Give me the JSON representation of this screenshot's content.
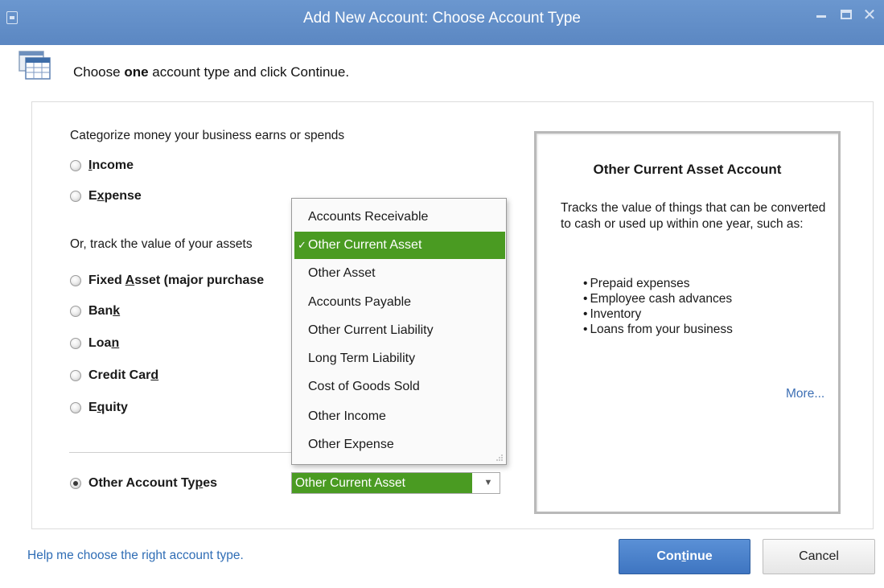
{
  "window": {
    "title": "Add New Account: Choose Account Type"
  },
  "header": {
    "instruction_pre": "Choose ",
    "instruction_bold": "one",
    "instruction_post": " account type and click Continue."
  },
  "left": {
    "categorize_label": "Categorize money your business earns or spends",
    "assets_label": "Or, track the value of your assets",
    "radio_options": [
      {
        "before": "",
        "mnemonic": "I",
        "after": "ncome",
        "checked": false
      },
      {
        "before": "E",
        "mnemonic": "x",
        "after": "pense",
        "checked": false
      },
      {
        "before": "Fixed ",
        "mnemonic": "A",
        "after": "sset (major purchase",
        "checked": false
      },
      {
        "before": "Ban",
        "mnemonic": "k",
        "after": "",
        "checked": false
      },
      {
        "before": "Loa",
        "mnemonic": "n",
        "after": "",
        "checked": false
      },
      {
        "before": "Credit Car",
        "mnemonic": "d",
        "after": "",
        "checked": false
      },
      {
        "before": "E",
        "mnemonic": "q",
        "after": "uity",
        "checked": false
      }
    ],
    "other_types": {
      "before": "Other Account Ty",
      "mnemonic": "p",
      "after": "es",
      "checked": true
    }
  },
  "combo": {
    "selected_value": "Other Current Asset"
  },
  "dropdown": {
    "items": [
      {
        "label": "Accounts Receivable",
        "selected": false
      },
      {
        "label": "Other Current Asset",
        "selected": true
      },
      {
        "label": "Other Asset",
        "selected": false
      },
      {
        "label": "Accounts Payable",
        "selected": false
      },
      {
        "label": "Other Current Liability",
        "selected": false
      },
      {
        "label": "Long Term Liability",
        "selected": false
      },
      {
        "label": "Cost of Goods Sold",
        "selected": false
      },
      {
        "label": "Other Income",
        "selected": false
      },
      {
        "label": "Other Expense",
        "selected": false
      }
    ],
    "check_mark": "✓"
  },
  "info": {
    "title": "Other Current Asset Account",
    "description": "Tracks the value of things that can be converted to cash or used up within one year, such as:",
    "bullets": [
      "Prepaid expenses",
      "Employee cash advances",
      "Inventory",
      "Loans from your business"
    ],
    "more_link": "More..."
  },
  "footer": {
    "help_link": "Help me choose the right account type.",
    "continue_before": "Con",
    "continue_mnemonic": "t",
    "continue_after": "inue",
    "cancel_label": "Cancel"
  },
  "colors": {
    "titlebar": "#5b87c2",
    "selection_green": "#4a9b22",
    "link_blue": "#2f6db5",
    "primary_button": "#3e75c1"
  },
  "icons": {
    "window_system": "window-system-icon",
    "header": "account-list-icon",
    "minimize": "minimize-icon",
    "maximize": "maximize-icon",
    "close": "close-icon",
    "dropdown_arrow": "chevron-down-icon",
    "resize_grip": "resize-grip-icon"
  }
}
